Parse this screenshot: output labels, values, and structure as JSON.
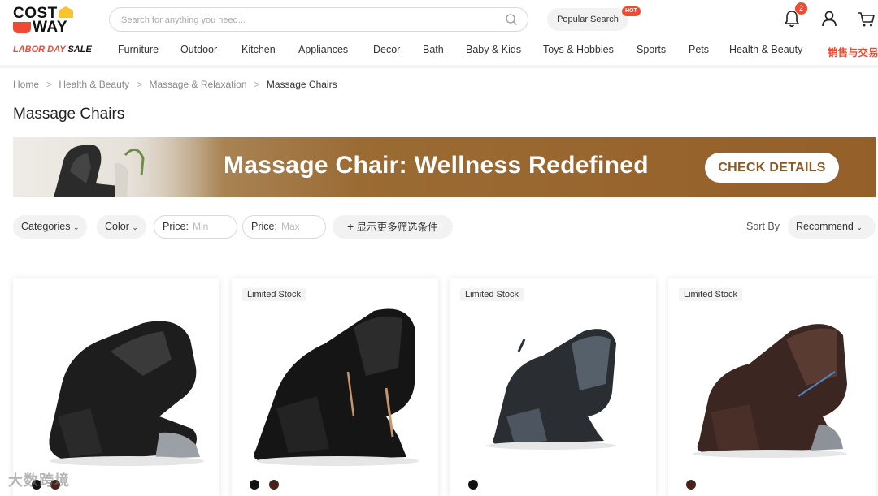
{
  "brand": {
    "line1": "COST",
    "line2": "WAY"
  },
  "search": {
    "placeholder": "Search for anything you need..."
  },
  "popular_search": {
    "label": "Popular Search",
    "badge": "HOT"
  },
  "cart_badge": "2",
  "nav": {
    "sale_a": "LABOR DAY",
    "sale_b": "SALE",
    "items": [
      "Furniture",
      "Outdoor",
      "Kitchen",
      "Appliances",
      "Decor",
      "Bath",
      "Baby & Kids",
      "Toys & Hobbies",
      "Sports",
      "Pets",
      "Health & Beauty",
      "销售与交易"
    ]
  },
  "breadcrumb": [
    "Home",
    "Health & Beauty",
    "Massage & Relaxation",
    "Massage Chairs"
  ],
  "page_title": "Massage Chairs",
  "banner": {
    "headline": "Massage Chair: Wellness Redefined",
    "cta": "CHECK DETAILS"
  },
  "filters": {
    "categories": "Categories",
    "color": "Color",
    "price_label": "Price:",
    "min_placeholder": "Min",
    "max_placeholder": "Max",
    "more": "显示更多筛选条件",
    "sort_label": "Sort By",
    "sort_value": "Recommend"
  },
  "products": [
    {
      "tag": "",
      "swatches": [
        "#111111",
        "#4a2218"
      ]
    },
    {
      "tag": "Limited Stock",
      "swatches": [
        "#111111",
        "#4a2218"
      ]
    },
    {
      "tag": "Limited Stock",
      "swatches": [
        "#111111"
      ]
    },
    {
      "tag": "Limited Stock",
      "swatches": [
        "#4a2218"
      ]
    }
  ],
  "watermark": "大数跨境",
  "colors": {
    "accent": "#ef4a32",
    "brand_yellow": "#f8c32b",
    "banner_brown": "#955f29"
  }
}
